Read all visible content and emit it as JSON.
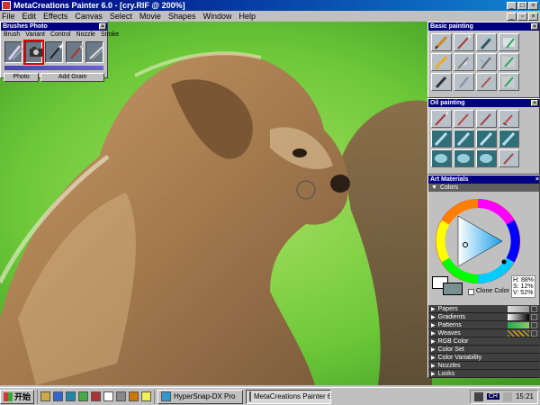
{
  "app": {
    "title": "MetaCreations Painter 6.0 - [cry.RIF @ 200%]"
  },
  "menu": [
    "File",
    "Edit",
    "Effects",
    "Canvas",
    "Select",
    "Movie",
    "Shapes",
    "Window",
    "Help"
  ],
  "brushes_palette": {
    "title": "Brushes Photo",
    "tabs": [
      "Brush",
      "Variant",
      "Control",
      "Nozzle",
      "Stroke"
    ],
    "buttons": [
      "Photo",
      "Add Grain"
    ]
  },
  "basic_painting": {
    "title": "Basic painting"
  },
  "oil_painting": {
    "title": "Oil painting"
  },
  "art_materials": {
    "title": "Art Materials",
    "colors_label": "Colors",
    "hsv": {
      "h": "H: 88%",
      "s": "S: 12%",
      "v": "V: 52%"
    },
    "clone_color": "Clone Color",
    "sections": [
      "Papers",
      "Gradients",
      "Patterns",
      "Weaves",
      "RGB Color",
      "Color Set",
      "Color Variability",
      "Nozzles",
      "Looks"
    ]
  },
  "taskbar": {
    "start": "开始",
    "tasks": [
      "HyperSnap-DX Pro",
      "MetaCreations Painter 6...."
    ],
    "tray_lang": "CH",
    "clock": "15:21"
  },
  "colors": {
    "titlebar": "#000080",
    "canvas_bg": "#5bb830",
    "primary_swatch": "#ffffff",
    "secondary_swatch": "#7a8f90"
  }
}
